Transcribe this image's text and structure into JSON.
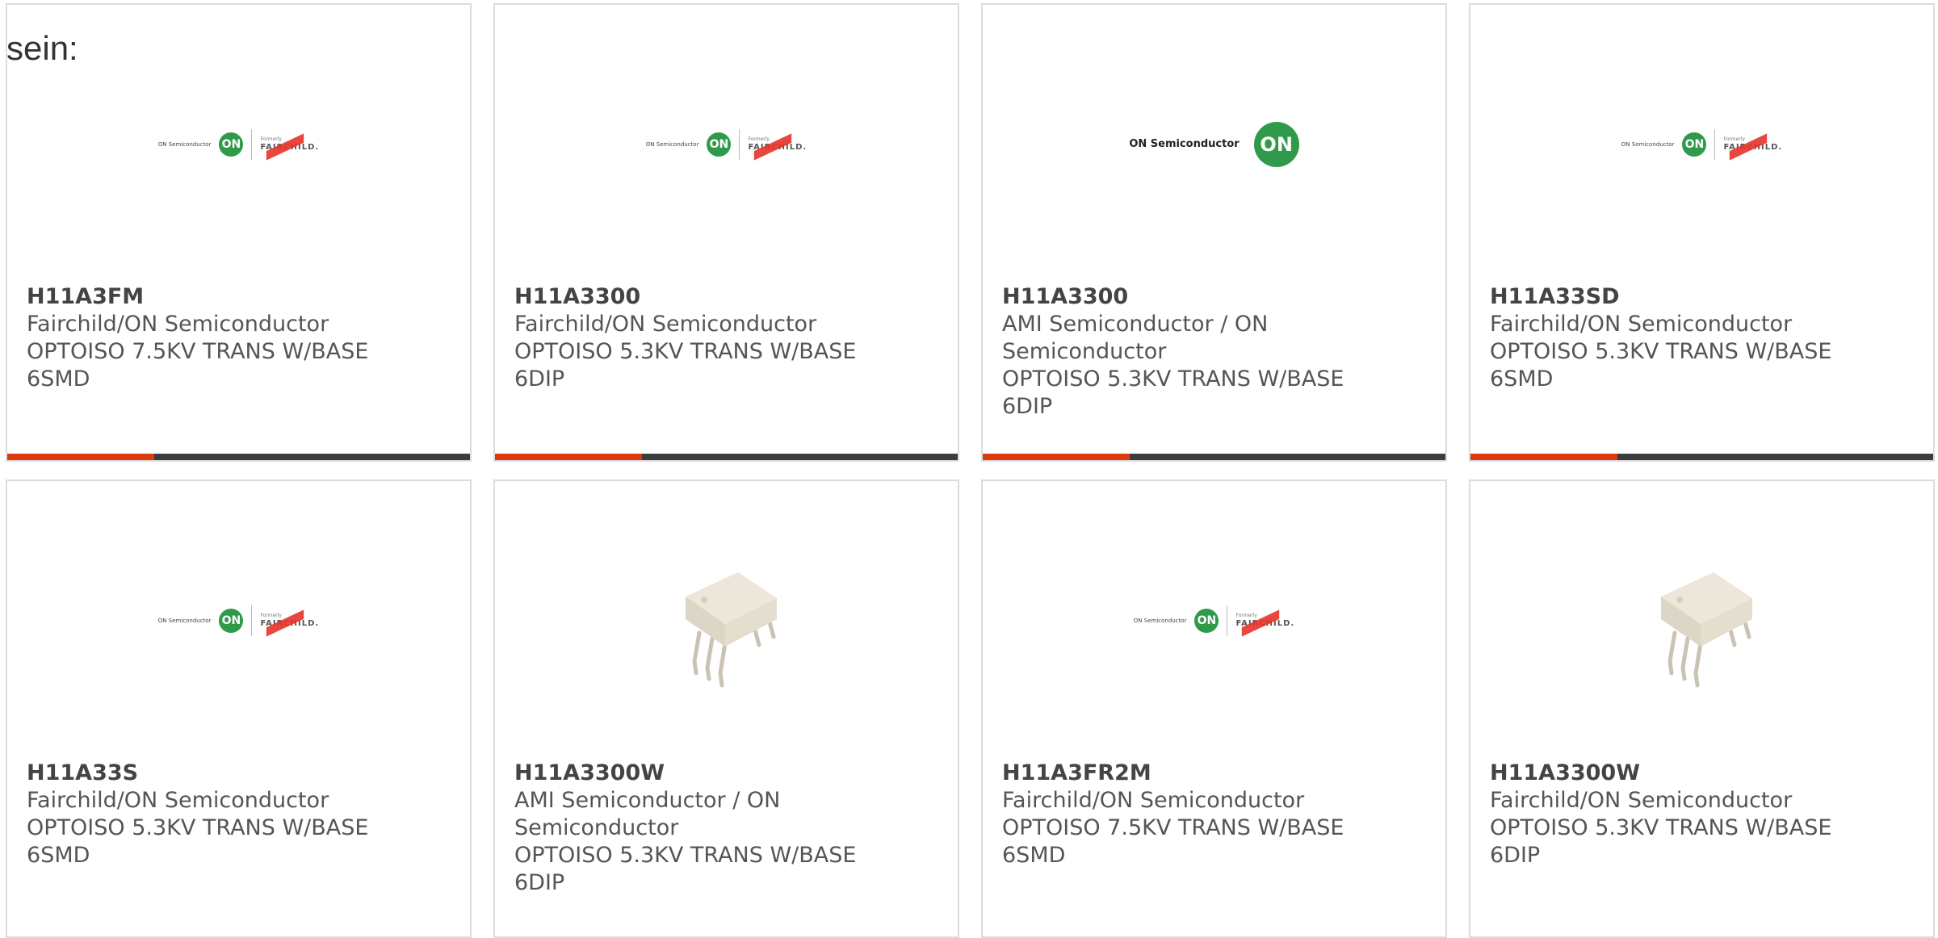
{
  "page": {
    "heading": "sein:"
  },
  "logos": {
    "on_text": "ON Semiconductor",
    "on_circle": "ON",
    "formerly": "Formerly",
    "fairchild": "FAIRCHILD."
  },
  "colors": {
    "accent": "#dd3a0e",
    "bar": "#3c3c3c",
    "border": "#dcdcdc",
    "on_green": "#2e9a4a"
  },
  "products": [
    {
      "part": "H11A3FM",
      "manufacturer": "Fairchild/ON Semiconductor",
      "description": "OPTOISO 7.5KV TRANS W/BASE",
      "package": "6SMD",
      "image": "on-fairchild-logo"
    },
    {
      "part": "H11A3300",
      "manufacturer": "Fairchild/ON Semiconductor",
      "description": "OPTOISO 5.3KV TRANS W/BASE",
      "package": "6DIP",
      "image": "on-fairchild-logo"
    },
    {
      "part": "H11A3300",
      "manufacturer": "AMI Semiconductor / ON Semiconductor",
      "description": "OPTOISO 5.3KV TRANS W/BASE",
      "package": "6DIP",
      "image": "on-semiconductor-logo"
    },
    {
      "part": "H11A33SD",
      "manufacturer": "Fairchild/ON Semiconductor",
      "description": "OPTOISO 5.3KV TRANS W/BASE",
      "package": "6SMD",
      "image": "on-fairchild-logo"
    },
    {
      "part": "H11A33S",
      "manufacturer": "Fairchild/ON Semiconductor",
      "description": "OPTOISO 5.3KV TRANS W/BASE",
      "package": "6SMD",
      "image": "on-fairchild-logo"
    },
    {
      "part": "H11A3300W",
      "manufacturer": "AMI Semiconductor / ON Semiconductor",
      "description": "OPTOISO 5.3KV TRANS W/BASE",
      "package": "6DIP",
      "image": "dip-chip-photo"
    },
    {
      "part": "H11A3FR2M",
      "manufacturer": "Fairchild/ON Semiconductor",
      "description": "OPTOISO 7.5KV TRANS W/BASE",
      "package": "6SMD",
      "image": "on-fairchild-logo"
    },
    {
      "part": "H11A3300W",
      "manufacturer": "Fairchild/ON Semiconductor",
      "description": "OPTOISO 5.3KV TRANS W/BASE",
      "package": "6DIP",
      "image": "dip-chip-photo"
    }
  ]
}
